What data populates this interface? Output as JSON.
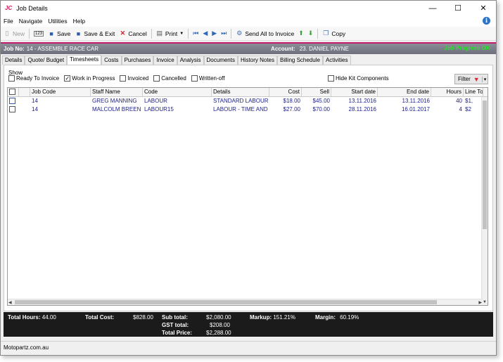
{
  "window": {
    "logo": "JC",
    "title": "Job Details",
    "minimize": "—",
    "maximize": "☐",
    "close": "✕"
  },
  "menu": [
    "File",
    "Navigate",
    "Utilities",
    "Help"
  ],
  "toolbar": {
    "new": "New",
    "num_icon": "123",
    "save": "Save",
    "save_exit": "Save & Exit",
    "cancel": "Cancel",
    "print": "Print",
    "send_all": "Send All to Invoice",
    "copy": "Copy"
  },
  "job": {
    "job_no_label": "Job No:",
    "job_no_value": "14 - ASSEMBLE RACE CAR",
    "account_label": "Account:",
    "account_value": "23. DANIEL PAYNE",
    "progress_text": "Job Progress OK"
  },
  "tabs": [
    "Details",
    "Quote/ Budget",
    "Timesheets",
    "Costs",
    "Purchases",
    "Invoice",
    "Analysis",
    "Documents",
    "History Notes",
    "Billing Schedule",
    "Activities"
  ],
  "active_tab": "Timesheets",
  "show": {
    "label": "Show",
    "options": [
      {
        "label": "Ready To Invoice",
        "checked": false
      },
      {
        "label": "Work in Progress",
        "checked": true
      },
      {
        "label": "Invoiced",
        "checked": false
      },
      {
        "label": "Cancelled",
        "checked": false
      },
      {
        "label": "Written-off",
        "checked": false
      }
    ],
    "hide_kit": "Hide Kit Components",
    "filter": "Filter"
  },
  "grid": {
    "columns": [
      "Job Code",
      "Staff Name",
      "Code",
      "Details",
      "Cost",
      "Sell",
      "Start date",
      "End date",
      "Hours",
      "Line To"
    ],
    "rows": [
      {
        "job_code": "14",
        "staff": "GREG MANNING",
        "code": "LABOUR",
        "details": "STANDARD LABOUR ...",
        "cost": "$18.00",
        "sell": "$45.00",
        "start": "13.11.2016",
        "end": "13.11.2016",
        "hours": "40",
        "line_total": "$1,"
      },
      {
        "job_code": "14",
        "staff": "MALCOLM BREEN",
        "code": "LABOUR15",
        "details": "LABOUR - TIME AND ...",
        "cost": "$27.00",
        "sell": "$70.00",
        "start": "28.11.2016",
        "end": "16.01.2017",
        "hours": "4",
        "line_total": "$2"
      }
    ]
  },
  "totals": {
    "total_hours_label": "Total Hours:",
    "total_hours": "44.00",
    "total_cost_label": "Total Cost:",
    "total_cost": "$828.00",
    "subtotal_label": "Sub total:",
    "subtotal": "$2,080.00",
    "gst_label": "GST total:",
    "gst": "$208.00",
    "total_price_label": "Total Price:",
    "total_price": "$2,288.00",
    "markup_label": "Markup:",
    "markup": "151.21%",
    "margin_label": "Margin:",
    "margin": "60.19%"
  },
  "status": "Motopartz.com.au"
}
